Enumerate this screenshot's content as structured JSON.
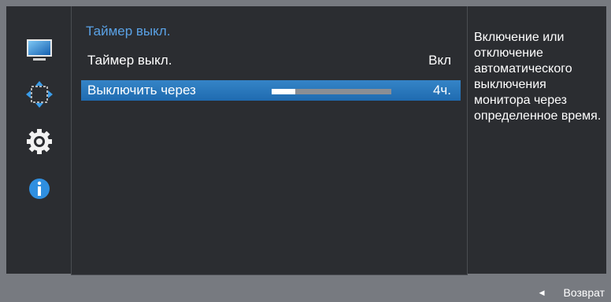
{
  "rail": {
    "icons": [
      "monitor-icon",
      "move-arrows-icon",
      "gear-icon",
      "info-icon"
    ],
    "selected": "gear-icon"
  },
  "panel": {
    "title": "Таймер выкл.",
    "rows": [
      {
        "label": "Таймер выкл.",
        "value": "Вкл"
      },
      {
        "label": "Выключить через",
        "value": "4ч.",
        "slider_level": 0.2
      }
    ]
  },
  "help": {
    "text": "Включение или отключение автоматического выключения монитора через определенное время."
  },
  "footer": {
    "back_label": "Возврат",
    "back_icon": "left-triangle-icon"
  },
  "colors": {
    "background": "#2b2d31",
    "frame": "#777a80",
    "title_accent": "#5aa2e6",
    "highlight": "#2a78bf"
  }
}
